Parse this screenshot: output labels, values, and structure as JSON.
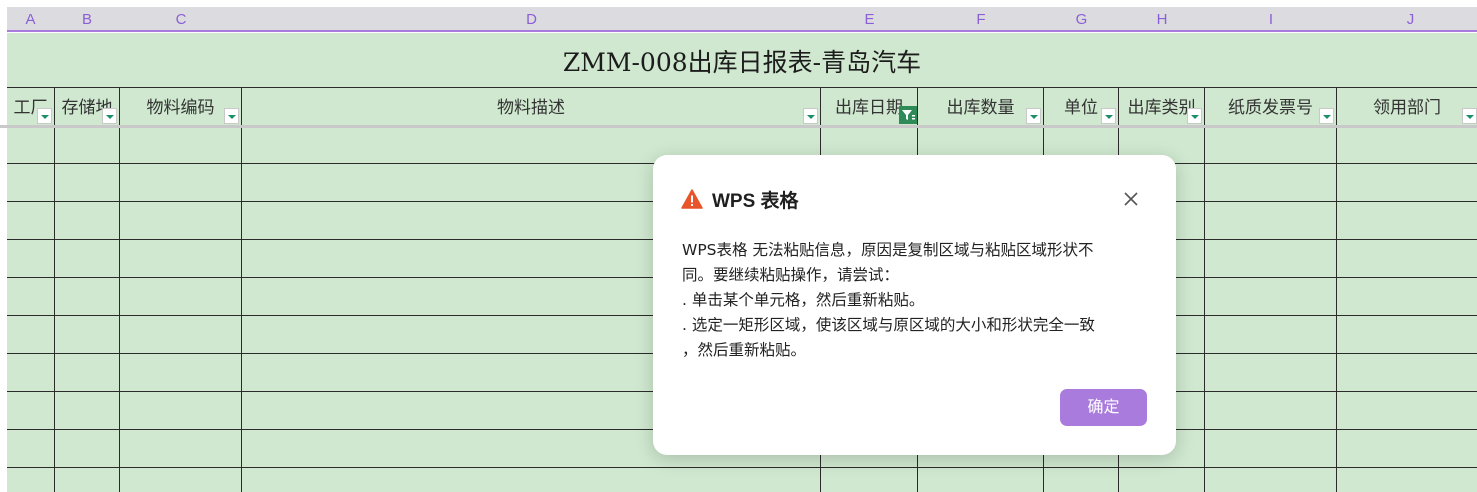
{
  "columns": [
    "A",
    "B",
    "C",
    "D",
    "E",
    "F",
    "G",
    "H",
    "I",
    "J"
  ],
  "sheet": {
    "title": "ZMM-008出库日报表-青岛汽车",
    "headers": [
      "工厂",
      "存储地",
      "物料编码",
      "物料描述",
      "出库日期",
      "出库数量",
      "单位",
      "出库类别",
      "纸质发票号",
      "领用部门"
    ],
    "active_filter_column": "出库日期",
    "colors": {
      "cell_background": "#cfe8cf",
      "grid_line": "#2b2b2b",
      "column_header_text": "#8b5fd6"
    }
  },
  "dialog": {
    "title": "WPS 表格",
    "message_lines": [
      "WPS表格 无法粘贴信息，原因是复制区域与粘贴区域形状不",
      "同。要继续粘贴操作，请尝试：",
      ". 单击某个单元格，然后重新粘贴。",
      ". 选定一矩形区域，使该区域与原区域的大小和形状完全一致",
      "，然后重新粘贴。"
    ],
    "ok_label": "确定",
    "icon": "warning-icon",
    "close_icon": "close-icon",
    "colors": {
      "accent": "#a97bdc",
      "warning": "#e8552b"
    }
  }
}
